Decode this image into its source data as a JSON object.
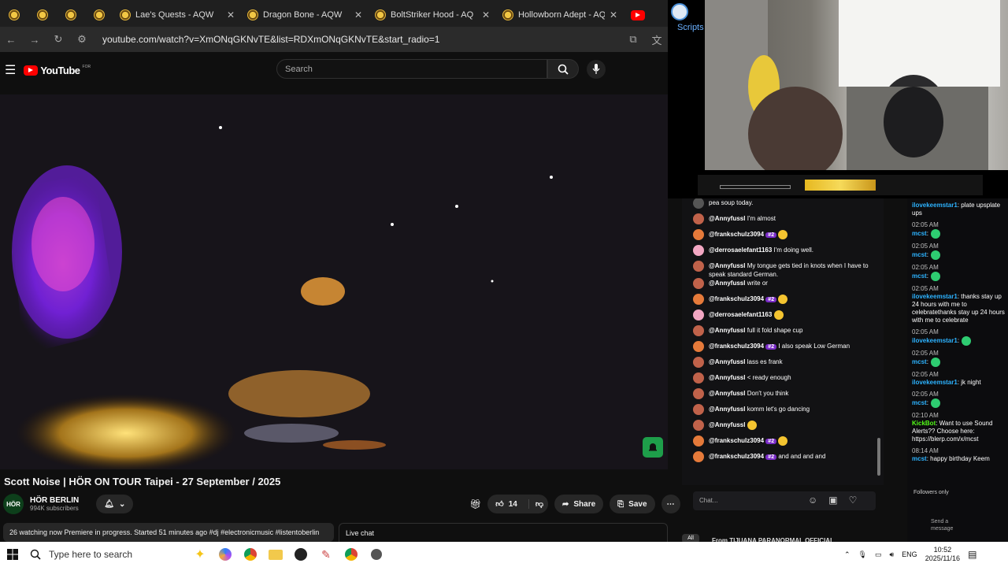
{
  "browser": {
    "tabs": [
      {
        "title": "Lae's Quests - AQW"
      },
      {
        "title": "Dragon Bone - AQW"
      },
      {
        "title": "BoltStriker Hood - AQ"
      },
      {
        "title": "Hollowborn Adept - AQ"
      }
    ],
    "url": "youtube.com/watch?v=XmONqGKNvTE&list=RDXmONqGKNvTE&start_radio=1"
  },
  "youtube": {
    "logo_text": "YouTube",
    "logo_sup": "FOR",
    "search_placeholder": "Search",
    "video_title": "Scott Noise | HÖR ON TOUR Taipei - 27 September / 2025",
    "channel_name": "HÖR BERLIN",
    "channel_avatar": "HÖR",
    "subscribers": "994K subscribers",
    "like_count": "14",
    "share_label": "Share",
    "save_label": "Save",
    "description": "26 watching now  Premiere in progress. Started 51 minutes ago  #dj #electronicmusic #listentoberlin",
    "live_chat_label": "Live chat",
    "bottom_partial": "From TIJUANA PARANORMAL OFFICIAL",
    "all_label": "All"
  },
  "overlay": {
    "scripts_label": "Scripts",
    "chat_input_placeholder": "Chat...",
    "followers_only": "Followers only",
    "send_message": "Send a message",
    "chat": [
      {
        "user": "",
        "text": "pea soup today.",
        "color": "#555"
      },
      {
        "user": "@Annyfussl",
        "text": "I'm almost",
        "color": "#c0624a"
      },
      {
        "user": "@frankschulz3094",
        "badge": "#2",
        "text": "",
        "color": "#e57a3a"
      },
      {
        "user": "@derrosaelefant1163",
        "text": "I'm doing well.",
        "color": "#f2a7c3"
      },
      {
        "user": "@Annyfussl",
        "text": "My tongue gets tied in knots when I have to speak standard German.",
        "color": "#c0624a"
      },
      {
        "user": "@Annyfussl",
        "text": "write or",
        "color": "#c0624a"
      },
      {
        "user": "@frankschulz3094",
        "badge": "#2",
        "text": "",
        "color": "#e57a3a"
      },
      {
        "user": "@derrosaelefant1163",
        "text": "",
        "color": "#f2a7c3"
      },
      {
        "user": "@Annyfussl",
        "text": "full it fold shape cup",
        "color": "#c0624a"
      },
      {
        "user": "@frankschulz3094",
        "badge": "#2",
        "text": "I also speak Low German",
        "color": "#e57a3a"
      },
      {
        "user": "@Annyfussl",
        "text": "lass es frank",
        "color": "#c0624a"
      },
      {
        "user": "@Annyfussl",
        "text": "< ready enough",
        "color": "#c0624a"
      },
      {
        "user": "@Annyfussl",
        "text": "Don't you think",
        "color": "#c0624a"
      },
      {
        "user": "@Annyfussl",
        "text": "komm let's go dancing",
        "color": "#c0624a"
      },
      {
        "user": "@Annyfussl",
        "text": "",
        "color": "#c0624a"
      },
      {
        "user": "@frankschulz3094",
        "badge": "#2",
        "text": "",
        "color": "#e57a3a"
      },
      {
        "user": "@frankschulz3094",
        "badge": "#2",
        "text": "and and and and",
        "color": "#e57a3a"
      }
    ],
    "side_chat": [
      {
        "time": "",
        "name": "ilovekeemstar1",
        "text": ": plate upsplate ups"
      },
      {
        "time": "02:05 AM",
        "name": "mcst",
        "text": ":"
      },
      {
        "time": "02:05 AM",
        "name": "mcst",
        "text": ":"
      },
      {
        "time": "02:05 AM",
        "name": "mcst",
        "text": ":"
      },
      {
        "time": "02:05 AM",
        "name": "ilovekeemstar1",
        "text": ": thanks stay up 24 hours with me to celebratethanks stay up 24 hours with me to celebrate"
      },
      {
        "time": "02:05 AM",
        "name": "ilovekeemstar1",
        "text": ":"
      },
      {
        "time": "02:05 AM",
        "name": "mcst",
        "text": ":"
      },
      {
        "time": "02:05 AM",
        "name": "ilovekeemstar1",
        "text": ": jk night"
      },
      {
        "time": "02:05 AM",
        "name": "mcst",
        "text": ":"
      },
      {
        "time": "02:10 AM",
        "name": "KickBot",
        "text": ": Want to use Sound Alerts?? Choose here: https://blerp.com/x/mcst"
      },
      {
        "time": "08:14 AM",
        "name": "mcst",
        "text": ": happy birthday Keem"
      }
    ]
  },
  "taskbar": {
    "search_placeholder": "Type here to search",
    "lang": "ENG",
    "time": "10:52",
    "date": "2025/11/16"
  },
  "colors": {
    "youtube_red": "#ff0000",
    "chat_badge": "#7a2cc7",
    "kick_green": "#53fc18"
  }
}
